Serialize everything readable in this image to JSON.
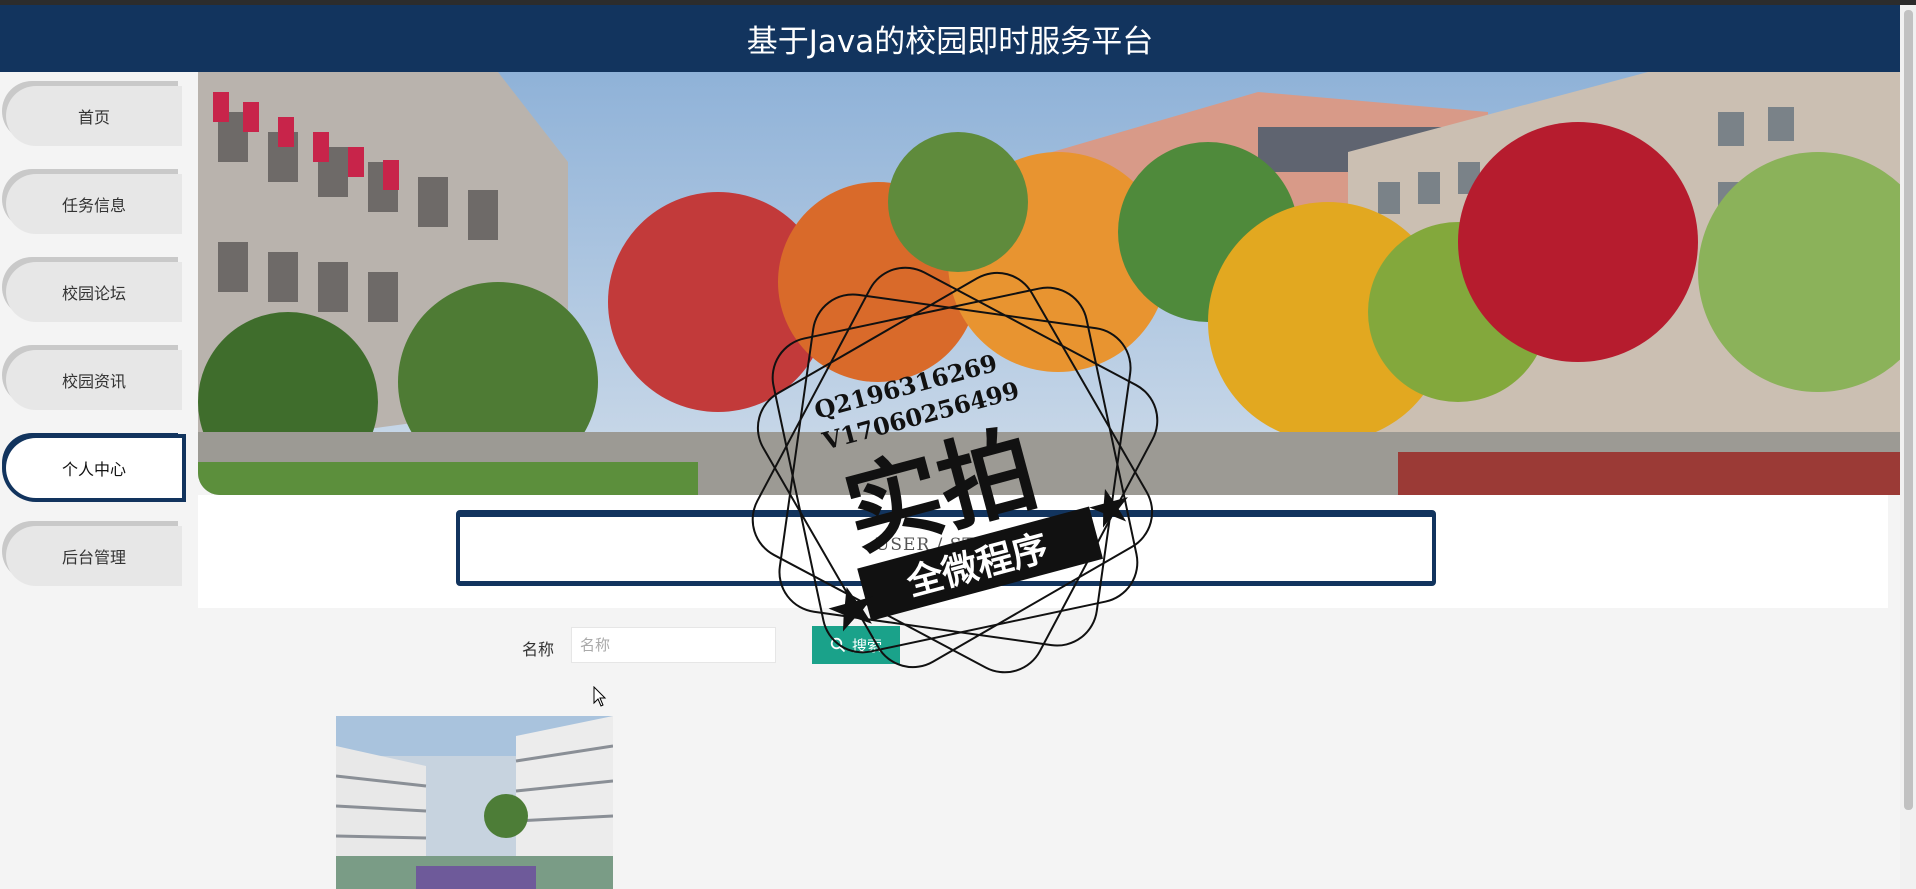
{
  "app": {
    "title": "基于Java的校园即时服务平台"
  },
  "colors": {
    "header": "#12345e",
    "accent": "#1aa28a",
    "background": "#f4f4f4"
  },
  "sidebar": {
    "items": [
      {
        "label": "首页",
        "active": false
      },
      {
        "label": "任务信息",
        "active": false
      },
      {
        "label": "校园论坛",
        "active": false
      },
      {
        "label": "校园资讯",
        "active": false
      },
      {
        "label": "个人中心",
        "active": true
      },
      {
        "label": "后台管理",
        "active": false
      }
    ]
  },
  "page": {
    "subtitle": "USER / STORE"
  },
  "search": {
    "label": "名称",
    "placeholder": "名称",
    "value": "",
    "button_label": "搜索",
    "button_icon": "search-icon"
  },
  "watermark": {
    "qq": "Q2196316269",
    "v": "V17060256499",
    "main": "实拍",
    "sub": "全微程序"
  }
}
